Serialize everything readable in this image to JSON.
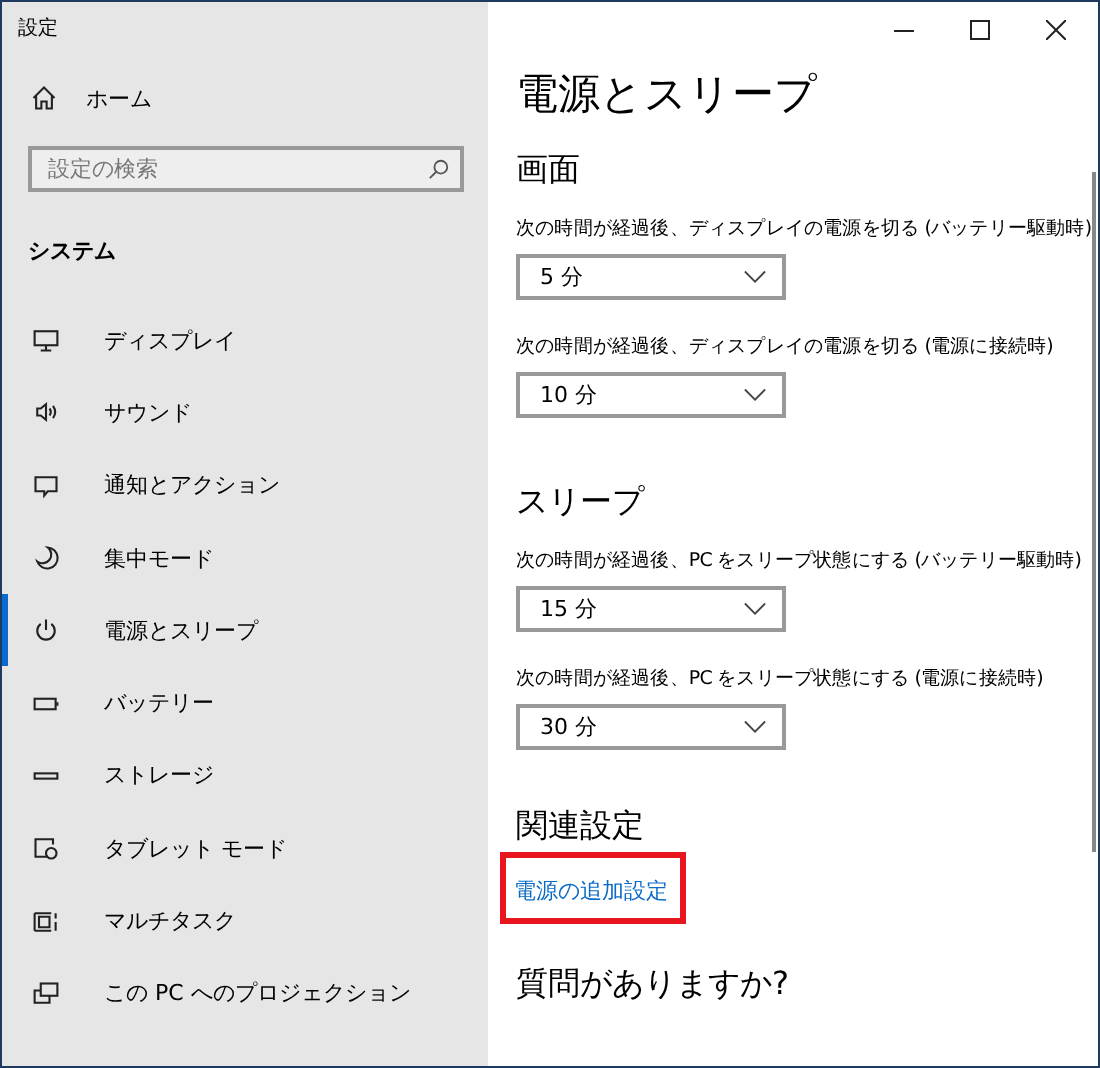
{
  "window": {
    "title": "設定"
  },
  "sidebar": {
    "home": "ホーム",
    "search": {
      "placeholder": "設定の検索"
    },
    "section": "システム",
    "items": [
      {
        "label": "ディスプレイ",
        "selected": false
      },
      {
        "label": "サウンド",
        "selected": false
      },
      {
        "label": "通知とアクション",
        "selected": false
      },
      {
        "label": "集中モード",
        "selected": false
      },
      {
        "label": "電源とスリープ",
        "selected": true
      },
      {
        "label": "バッテリー",
        "selected": false
      },
      {
        "label": "ストレージ",
        "selected": false
      },
      {
        "label": "タブレット モード",
        "selected": false
      },
      {
        "label": "マルチタスク",
        "selected": false
      },
      {
        "label": "この PC へのプロジェクション",
        "selected": false
      }
    ]
  },
  "page": {
    "title": "電源とスリープ",
    "sections": [
      {
        "heading": "画面",
        "settings": [
          {
            "label": "次の時間が経過後、ディスプレイの電源を切る (バッテリー駆動時)",
            "value": "5 分"
          },
          {
            "label": "次の時間が経過後、ディスプレイの電源を切る (電源に接続時)",
            "value": "10 分"
          }
        ]
      },
      {
        "heading": "スリープ",
        "settings": [
          {
            "label": "次の時間が経過後、PC をスリープ状態にする (バッテリー駆動時)",
            "value": "15 分"
          },
          {
            "label": "次の時間が経過後、PC をスリープ状態にする (電源に接続時)",
            "value": "30 分"
          }
        ]
      }
    ],
    "related": {
      "heading": "関連設定",
      "link": "電源の追加設定",
      "highlighted": true
    },
    "question": "質問がありますか?"
  }
}
